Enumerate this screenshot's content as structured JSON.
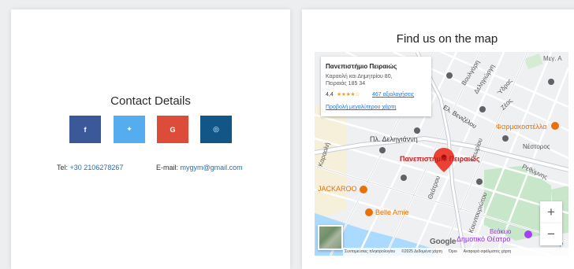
{
  "contact": {
    "title": "Contact Details",
    "social": [
      {
        "label": "f",
        "icon": "facebook-icon",
        "color": "#3b5998"
      },
      {
        "label": "✦",
        "icon": "twitter-icon",
        "color": "#55acee"
      },
      {
        "label": "G",
        "icon": "google-icon",
        "color": "#dd4b39"
      },
      {
        "label": "◎",
        "icon": "instagram-icon",
        "color": "#125688"
      }
    ],
    "tel_label": "Tel:",
    "tel_value": "+30 2106278267",
    "email_label": "E-mail:",
    "email_value": "mygym@gmail.com"
  },
  "map": {
    "title": "Find us on the map",
    "info": {
      "name": "Πανεπιστήμιο Πειραιώς",
      "address_line1": "Καραολή και Δημητρίου 80,",
      "address_line2": "Πειραιάς 185 34",
      "rating": "4,4",
      "stars": "★★★★☆",
      "reviews": "467 αξιολογήσεις",
      "larger_map": "Προβολή μεγαλύτερου χάρτη"
    },
    "pin_label": "Πανεπιστήμιο Πειραιώς",
    "places": {
      "jackaroo": "JACKAROO",
      "belle_amie": "Belle Amie",
      "farmakostella": "Φαρμακοστέλλα",
      "theatre_line1": "Βεάκειο",
      "theatre_line2": "Δημοτικό Θέατρο",
      "deligianni": "Πλ. Δεληγιάννη",
      "mikras": "Μικρ",
      "meg": "Μεγ. Α"
    },
    "streets": {
      "boulgari": "Βουλγάρη",
      "ydras": "Ύδρας",
      "nestoros": "Νέστορος",
      "zeas": "Ζέας",
      "el_venizelou": "Ελ. Βενιζέλου",
      "theatrou": "Θεάτρου",
      "neorion": "Νεωρίου",
      "rethymnis": "Ρεθύμνης",
      "kountouriotou": "Κουντουριώτου",
      "karaoli": "Καραολή",
      "deligiorgi": "Δεληγιώργη"
    },
    "zoom_in": "+",
    "zoom_out": "−",
    "google": "Google",
    "footer": {
      "shortcuts": "Συντομεύσεις πληκτρολογίου",
      "data": "©2025 Δεδομένα χάρτη",
      "terms": "Όροι",
      "report": "Αναφορά σφάλματος χάρτη"
    },
    "colors": {
      "pin": "#ea4335",
      "pin_label": "#c5221f",
      "place_orange": "#e8710a",
      "park": "#c8e6c9",
      "water": "#aadaff"
    }
  }
}
